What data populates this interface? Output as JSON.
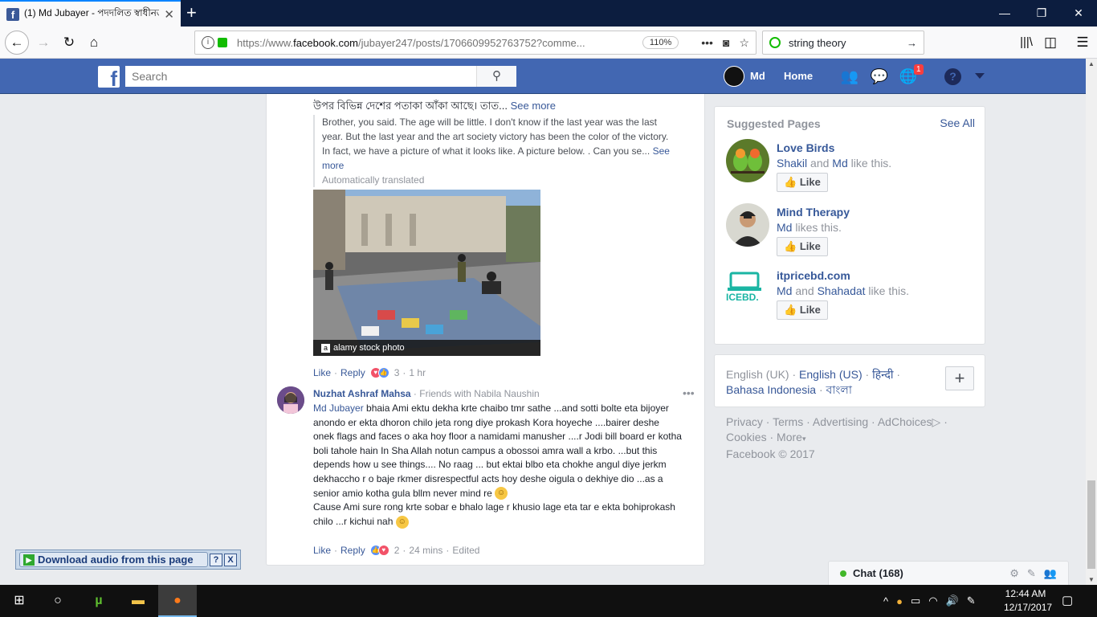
{
  "browser": {
    "tab_title": "(1) Md Jubayer - পদদলিত স্বাধীনতা",
    "url_prefix": "https://www.",
    "url_domain": "facebook.com",
    "url_path": "/jubayer247/posts/1706609952763752?comme...",
    "zoom": "110%",
    "search_query": "string theory"
  },
  "fb": {
    "search_placeholder": "Search",
    "user_name": "Md",
    "home_label": "Home",
    "notification_count": "1"
  },
  "comment1": {
    "bangla_line": "উপর বিভিন্ন দেশের পতাকা আঁকা আছে। তাত...",
    "bangla_see_more": "See more",
    "translation": "Brother, you said. The age will be little. I don't know if the last year was the last year. But the last year and the art society victory has been the color of the victory. In fact, we have a picture of what it looks like. A picture below. . Can you se...",
    "translation_see_more": "See more",
    "auto_translated": "Automatically translated",
    "photo_caption": "alamy stock photo",
    "photo_logo": "a",
    "like": "Like",
    "reply": "Reply",
    "reaction_count": "3",
    "time": "1 hr"
  },
  "comment2": {
    "author": "Nuzhat Ashraf Mahsa",
    "friends_with": "· Friends with Nabila Naushin",
    "mention": "Md Jubayer",
    "text_main": " bhaia Ami ektu dekha krte chaibo tmr sathe ...and sotti bolte eta bijoyer anondo er ekta dhoron chilo jeta rong diye prokash Kora hoyeche ....bairer deshe onek flags and faces o aka hoy floor a namidami manusher ....r Jodi bill board er kotha boli tahole hain In Sha Allah notun campus a obossoi amra wall a krbo. ...but this depends how u see things.... No raag ... but ektai blbo eta chokhe angul diye jerkm dekhaccho r o baje rkmer disrespectful acts hoy deshe oigula o dekhiye dio ...as a senior amio kotha gula bllm never mind re",
    "text_second": "Cause Ami sure rong krte sobar e bhalo lage r khusio lage eta tar e ekta bohiprokash chilo ...r kichui nah",
    "like": "Like",
    "reply": "Reply",
    "reaction_count": "2",
    "time": "24 mins",
    "edited": "Edited"
  },
  "suggested": {
    "title": "Suggested Pages",
    "see_all": "See All",
    "pages": [
      {
        "name": "Love Birds",
        "liker1": "Shakil",
        "joiner": " and ",
        "liker2": "Md",
        "suffix": " like this.",
        "like": "Like"
      },
      {
        "name": "Mind Therapy",
        "liker1": "Md",
        "joiner": "",
        "liker2": "",
        "suffix": " likes this.",
        "like": "Like"
      },
      {
        "name": "itpricebd.com",
        "liker1": "Md",
        "joiner": " and ",
        "liker2": "Shahadat",
        "suffix": " like this.",
        "like": "Like"
      }
    ]
  },
  "languages": {
    "current": "English (UK)",
    "sep": " · ",
    "l1": "English (US)",
    "l2": "हिन्दी",
    "l3": "Bahasa Indonesia",
    "l4": "বাংলা"
  },
  "footer": {
    "privacy": "Privacy",
    "terms": "Terms",
    "advertising": "Advertising",
    "adchoices": "AdChoices",
    "cookies": "Cookies",
    "more": "More",
    "copyright": "Facebook © 2017"
  },
  "chat": {
    "label": "Chat (168)"
  },
  "download_bar": {
    "label": "Download audio from this page",
    "help": "?",
    "close": "X"
  },
  "taskbar": {
    "time": "12:44 AM",
    "date": "12/17/2017"
  },
  "colors": {
    "fb_blue": "#4267b2",
    "link": "#385898",
    "online": "#42b72a"
  }
}
